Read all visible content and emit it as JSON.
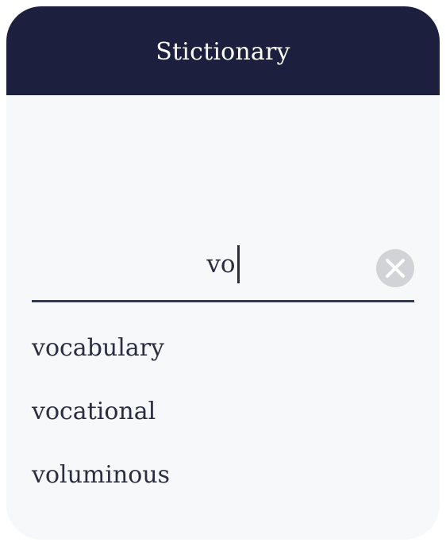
{
  "header": {
    "title": "Stictionary"
  },
  "search": {
    "value": "vo",
    "clear_icon": "close-circle-icon"
  },
  "suggestions": [
    "vocabulary",
    "vocational",
    "voluminous"
  ],
  "colors": {
    "header_bg": "#1c1f3d",
    "card_bg": "#f7f8fa",
    "text": "#2b2d42",
    "underline": "#333a4d",
    "clear_bg": "#d2d3d7"
  }
}
